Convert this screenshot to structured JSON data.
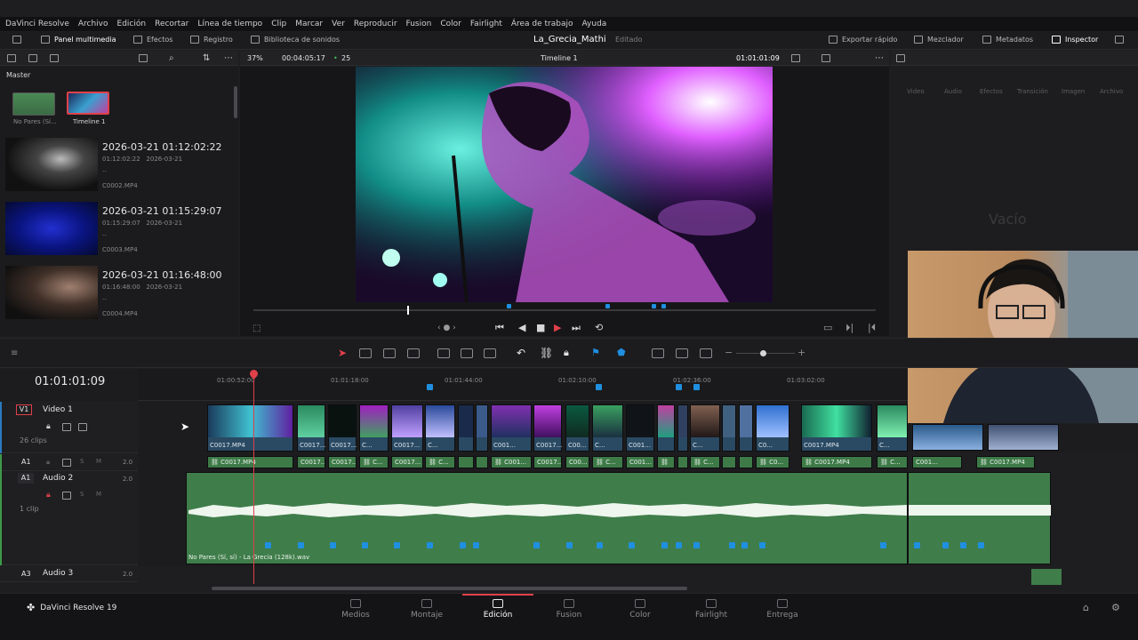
{
  "menu": [
    "DaVinci Resolve",
    "Archivo",
    "Edición",
    "Recortar",
    "Línea de tiempo",
    "Clip",
    "Marcar",
    "Ver",
    "Reproducir",
    "Fusion",
    "Color",
    "Fairlight",
    "Área de trabajo",
    "Ayuda"
  ],
  "toolbar": {
    "media_pool": "Panel multimedia",
    "effects": "Efectos",
    "index": "Registro",
    "sound_library": "Biblioteca de sonidos",
    "project_name": "La_Grecia_Mathi",
    "project_status": "Editado",
    "quick_export": "Exportar rápido",
    "mixer": "Mezclador",
    "metadata": "Metadatos",
    "inspector": "Inspector"
  },
  "viewer_bar": {
    "zoom": "37%",
    "duration": "00:04:05:17",
    "fps": "25",
    "timeline_name": "Timeline 1",
    "timecode": "01:01:01:09"
  },
  "media_pool": {
    "bin": "Master",
    "thumbs": [
      {
        "label": "No Pares (Sí..."
      },
      {
        "label": "Timeline 1"
      }
    ],
    "clips": [
      {
        "title": "2026-03-21  01:12:02:22",
        "tc": "01:12:02:22",
        "date": "2026-03-21",
        "dash": "--",
        "file": "C0002.MP4"
      },
      {
        "title": "2026-03-21  01:15:29:07",
        "tc": "01:15:29:07",
        "date": "2026-03-21",
        "dash": "--",
        "file": "C0003.MP4"
      },
      {
        "title": "2026-03-21  01:16:48:00",
        "tc": "01:16:48:00",
        "date": "2026-03-21",
        "dash": "--",
        "file": "C0004.MP4"
      }
    ]
  },
  "inspector": {
    "tabs": [
      "Video",
      "Audio",
      "Efectos",
      "Transición",
      "Imagen",
      "Archivo"
    ],
    "empty": "Vacío"
  },
  "timeline": {
    "timecode": "01:01:01:09",
    "ruler": [
      "01:00:52:00",
      "01:01:18:00",
      "01:01:44:00",
      "01:02:10:00",
      "01:02:36:00",
      "01:03:02:00"
    ],
    "tracks": {
      "v1": {
        "id": "V1",
        "name": "Video 1",
        "count": "26 clips"
      },
      "a1": {
        "id": "A1",
        "vol": "2.0"
      },
      "a2": {
        "id": "A1",
        "name": "Audio 2",
        "vol": "2.0",
        "count": "1 clip"
      },
      "a3": {
        "id": "A3",
        "name": "Audio 3",
        "vol": "2.0"
      }
    },
    "video_clip_main": "C0017.MP4",
    "audio_file": "No Pares (Sí, sí) - La Grecia (128k).wav"
  },
  "pages": [
    "Medios",
    "Montaje",
    "Edición",
    "Fusion",
    "Color",
    "Fairlight",
    "Entrega"
  ],
  "app": {
    "name": "DaVinci Resolve 19"
  },
  "colors": {
    "accent": "#1f8fe0",
    "playhead": "#e0404a",
    "audio": "#3d7a48",
    "video": "#2a4a63"
  }
}
